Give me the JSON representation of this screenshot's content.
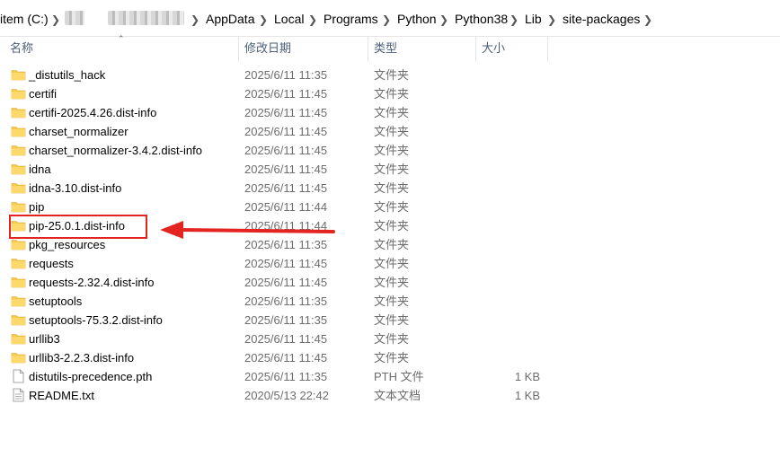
{
  "breadcrumb": {
    "items": [
      "item (C:)",
      "AppData",
      "Local",
      "Programs",
      "Python",
      "Python38",
      "Lib",
      "site-packages"
    ]
  },
  "columns": {
    "name": "名称",
    "date": "修改日期",
    "type": "类型",
    "size": "大小"
  },
  "files": [
    {
      "name": "_distutils_hack",
      "date": "2025/6/11 11:35",
      "type": "文件夹",
      "size": "",
      "icon": "folder-icon"
    },
    {
      "name": "certifi",
      "date": "2025/6/11 11:45",
      "type": "文件夹",
      "size": "",
      "icon": "folder-icon"
    },
    {
      "name": "certifi-2025.4.26.dist-info",
      "date": "2025/6/11 11:45",
      "type": "文件夹",
      "size": "",
      "icon": "folder-icon"
    },
    {
      "name": "charset_normalizer",
      "date": "2025/6/11 11:45",
      "type": "文件夹",
      "size": "",
      "icon": "folder-icon"
    },
    {
      "name": "charset_normalizer-3.4.2.dist-info",
      "date": "2025/6/11 11:45",
      "type": "文件夹",
      "size": "",
      "icon": "folder-icon"
    },
    {
      "name": "idna",
      "date": "2025/6/11 11:45",
      "type": "文件夹",
      "size": "",
      "icon": "folder-icon"
    },
    {
      "name": "idna-3.10.dist-info",
      "date": "2025/6/11 11:45",
      "type": "文件夹",
      "size": "",
      "icon": "folder-icon"
    },
    {
      "name": "pip",
      "date": "2025/6/11 11:44",
      "type": "文件夹",
      "size": "",
      "icon": "folder-icon"
    },
    {
      "name": "pip-25.0.1.dist-info",
      "date": "2025/6/11 11:44",
      "type": "文件夹",
      "size": "",
      "icon": "folder-icon"
    },
    {
      "name": "pkg_resources",
      "date": "2025/6/11 11:35",
      "type": "文件夹",
      "size": "",
      "icon": "folder-icon"
    },
    {
      "name": "requests",
      "date": "2025/6/11 11:45",
      "type": "文件夹",
      "size": "",
      "icon": "folder-icon"
    },
    {
      "name": "requests-2.32.4.dist-info",
      "date": "2025/6/11 11:45",
      "type": "文件夹",
      "size": "",
      "icon": "folder-icon"
    },
    {
      "name": "setuptools",
      "date": "2025/6/11 11:35",
      "type": "文件夹",
      "size": "",
      "icon": "folder-icon"
    },
    {
      "name": "setuptools-75.3.2.dist-info",
      "date": "2025/6/11 11:35",
      "type": "文件夹",
      "size": "",
      "icon": "folder-icon"
    },
    {
      "name": "urllib3",
      "date": "2025/6/11 11:45",
      "type": "文件夹",
      "size": "",
      "icon": "folder-icon"
    },
    {
      "name": "urllib3-2.2.3.dist-info",
      "date": "2025/6/11 11:45",
      "type": "文件夹",
      "size": "",
      "icon": "folder-icon"
    },
    {
      "name": "distutils-precedence.pth",
      "date": "2025/6/11 11:35",
      "type": "PTH 文件",
      "size": "1 KB",
      "icon": "file-icon"
    },
    {
      "name": "README.txt",
      "date": "2020/5/13 22:42",
      "type": "文本文档",
      "size": "1 KB",
      "icon": "text-file-icon"
    }
  ],
  "highlight": {
    "row_index": 8,
    "color": "#e32420"
  },
  "colors": {
    "folder": "#f8c94a",
    "header_text": "#4c607a",
    "meta_text": "#6d6d6d",
    "annotation": "#e32420"
  }
}
